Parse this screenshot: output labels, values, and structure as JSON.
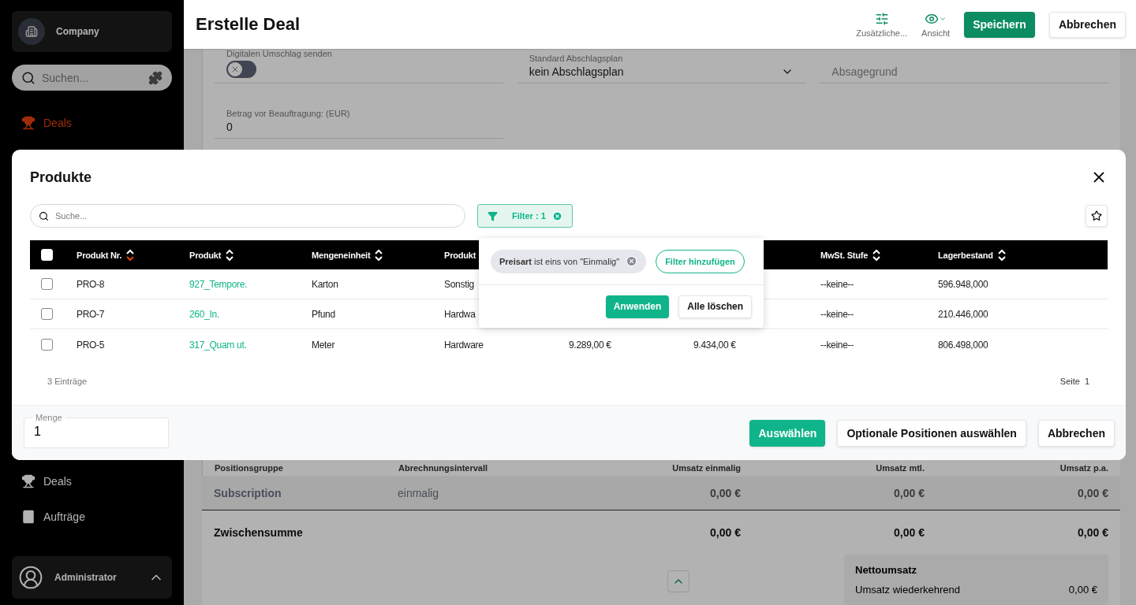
{
  "sidebar": {
    "company": "Company",
    "search": {
      "placeholder": "Suchen..."
    },
    "items": [
      {
        "label": "Deals",
        "selected": true
      }
    ],
    "bottom_items": [
      {
        "label": "Deals",
        "selected": false
      },
      {
        "label": "Aufträge",
        "selected": false
      }
    ],
    "user": "Administrator"
  },
  "header": {
    "title": "Erstelle Deal",
    "tools": [
      {
        "label": "Zusätzliche..."
      },
      {
        "label": "Ansicht"
      }
    ],
    "buttons": [
      {
        "label": "Speichern",
        "kind": "primary"
      },
      {
        "label": "Abbrechen",
        "kind": "secondary"
      }
    ]
  },
  "form": {
    "rows": [
      [
        {
          "kind": "toggle",
          "label": "Digitalen Umschlag senden",
          "on": false
        },
        {
          "kind": "select",
          "label": "Standard Abschlagsplan",
          "value": "kein Abschlagsplan"
        },
        {
          "kind": "text",
          "placeholder": "Absagegrund"
        }
      ],
      [
        {
          "kind": "text",
          "label": "Betrag vor Beauftragung: (EUR)",
          "value": "0"
        }
      ]
    ]
  },
  "summary": {
    "columns": [
      "Positionsgruppe",
      "Abrechnungsintervall",
      "Umsatz einmalig",
      "Umsatz mtl.",
      "Umsatz p.a."
    ],
    "rows": [
      {
        "kind": "group",
        "cells": [
          "Subscription",
          "einmalig",
          "0,00 €",
          "0,00 €",
          "0,00 €"
        ]
      },
      {
        "kind": "total",
        "cells": [
          "Zwischensumme",
          null,
          "0,00 €",
          "0,00 €",
          "0,00 €"
        ]
      }
    ],
    "net": {
      "title": "Nettoumsatz",
      "rows": [
        {
          "label": "Umsatz wiederkehrend",
          "value": "0,00 €"
        }
      ]
    }
  },
  "modal": {
    "title": "Produkte",
    "search": {
      "placeholder": "Suche..."
    },
    "filter": {
      "label": "Filter : 1"
    },
    "popover": {
      "chip": {
        "field": "Preisart",
        "text": "ist eins von \"Einmalig\""
      },
      "add": "Filter hinzufügen",
      "apply": "Anwenden",
      "clear": "Alle löschen"
    },
    "all_checked": false,
    "columns": [
      {
        "label": "Produkt Nr.",
        "kind": "text",
        "sorted": true
      },
      {
        "label": "Produkt",
        "kind": "link",
        "sorted": false
      },
      {
        "label": "Mengeneinheit",
        "kind": "text",
        "sorted": false
      },
      {
        "label": "Produkt",
        "kind": "text"
      },
      {
        "kind": "text"
      },
      {
        "kind": "text"
      },
      {
        "label": "MwSt. Stufe",
        "kind": "text",
        "sorted": false
      },
      {
        "label": "Lagerbestand",
        "kind": "text",
        "sorted": false
      }
    ],
    "rows": [
      {
        "checked": false,
        "cells": [
          "PRO-8",
          "927_Tempore.",
          "Karton",
          "Sonstig",
          null,
          null,
          "--keine--",
          "596.948,000"
        ]
      },
      {
        "checked": false,
        "cells": [
          "PRO-7",
          "260_In.",
          "Pfund",
          "Hardwa",
          null,
          null,
          "--keine--",
          "210.446,000"
        ]
      },
      {
        "checked": false,
        "cells": [
          "PRO-5",
          "317_Quam ut.",
          "Meter",
          "Hardware",
          "9.289,00 €",
          "9.434,00 €",
          "--keine--",
          "806.498,000"
        ]
      }
    ],
    "count": "3 Einträge",
    "page_label": "Seite",
    "page": "1",
    "quantity": {
      "label": "Menge",
      "value": "1"
    },
    "buttons": [
      {
        "label": "Auswählen",
        "kind": "primary"
      },
      {
        "label": "Optionale Positionen auswählen",
        "kind": "secondary"
      },
      {
        "label": "Abbrechen",
        "kind": "secondary"
      }
    ]
  }
}
